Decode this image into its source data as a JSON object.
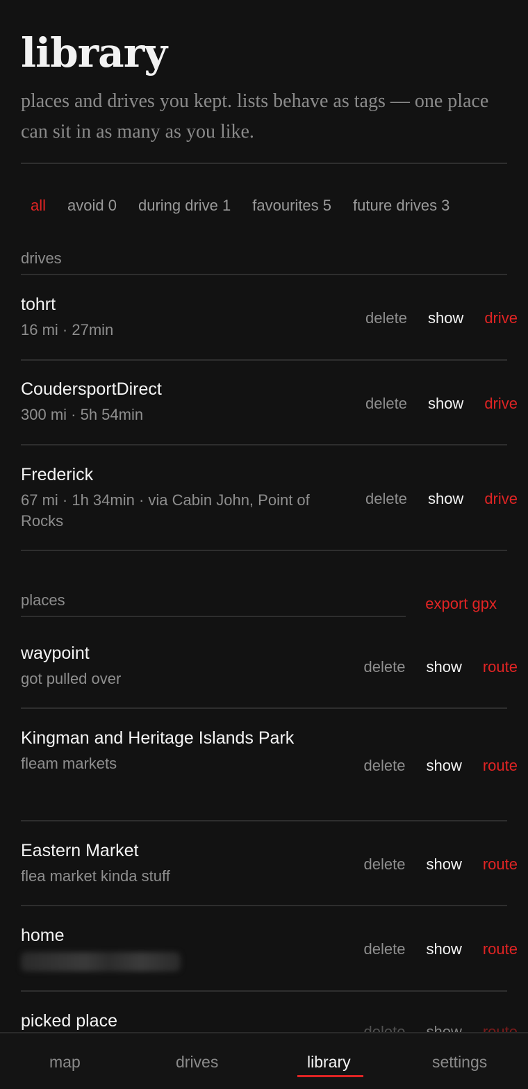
{
  "header": {
    "title": "library",
    "subtitle": "places and drives you kept. lists behave as tags — one place can sit in as many as you like."
  },
  "filters": [
    {
      "label": "all",
      "active": true
    },
    {
      "label": "avoid 0",
      "active": false
    },
    {
      "label": "during drive 1",
      "active": false
    },
    {
      "label": "favourites 5",
      "active": false
    },
    {
      "label": "future drives 3",
      "active": false
    }
  ],
  "drives": {
    "label": "drives",
    "items": [
      {
        "name": "tohrt",
        "detail": "16 mi · 27min"
      },
      {
        "name": "CoudersportDirect",
        "detail": "300 mi · 5h 54min"
      },
      {
        "name": "Frederick",
        "detail": "67 mi · 1h 34min · via Cabin John, Point of Rocks"
      }
    ],
    "actions": {
      "delete": "delete",
      "show": "show",
      "go": "drive"
    }
  },
  "places": {
    "label": "places",
    "export_label": "export gpx",
    "items": [
      {
        "name": "waypoint",
        "detail": "got pulled over"
      },
      {
        "name": "Kingman and Heritage Islands Park",
        "detail": "fleam markets"
      },
      {
        "name": "Eastern Market",
        "detail": "flea market kinda stuff"
      },
      {
        "name": "home",
        "detail": ""
      },
      {
        "name": "picked place",
        "detail": ""
      }
    ],
    "actions": {
      "delete": "delete",
      "show": "show",
      "go": "route"
    }
  },
  "nav": {
    "items": [
      {
        "label": "map",
        "active": false
      },
      {
        "label": "drives",
        "active": false
      },
      {
        "label": "library",
        "active": true
      },
      {
        "label": "settings",
        "active": false
      }
    ]
  },
  "colors": {
    "accent": "#e02424",
    "background": "#121212",
    "muted": "#8e8e8e"
  }
}
